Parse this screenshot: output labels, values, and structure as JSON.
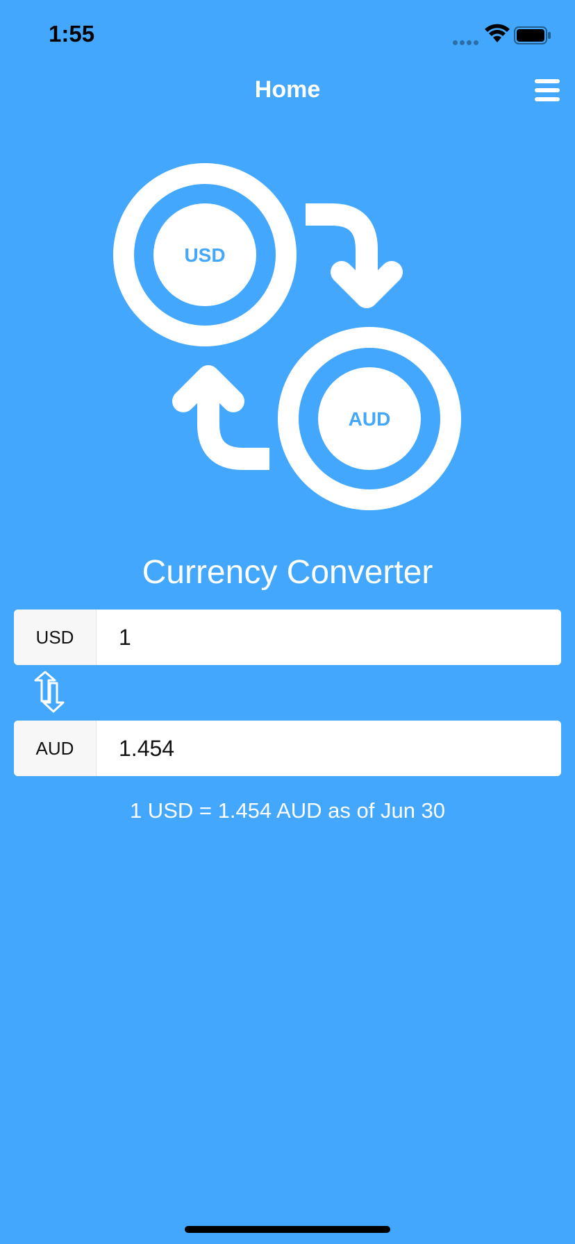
{
  "status_bar": {
    "time": "1:55"
  },
  "nav": {
    "title": "Home"
  },
  "hero": {
    "top_circle_label": "USD",
    "bottom_circle_label": "AUD"
  },
  "converter": {
    "title": "Currency Converter",
    "from": {
      "code": "USD",
      "value": "1"
    },
    "to": {
      "code": "AUD",
      "value": "1.454"
    },
    "rate_text": "1 USD = 1.454 AUD as of Jun 30"
  },
  "colors": {
    "background": "#43A8FD",
    "accent": "#43A8FD",
    "foreground": "#FFFFFF"
  },
  "icons": [
    "wifi-icon",
    "battery-icon",
    "menu-icon",
    "swap-icon"
  ]
}
